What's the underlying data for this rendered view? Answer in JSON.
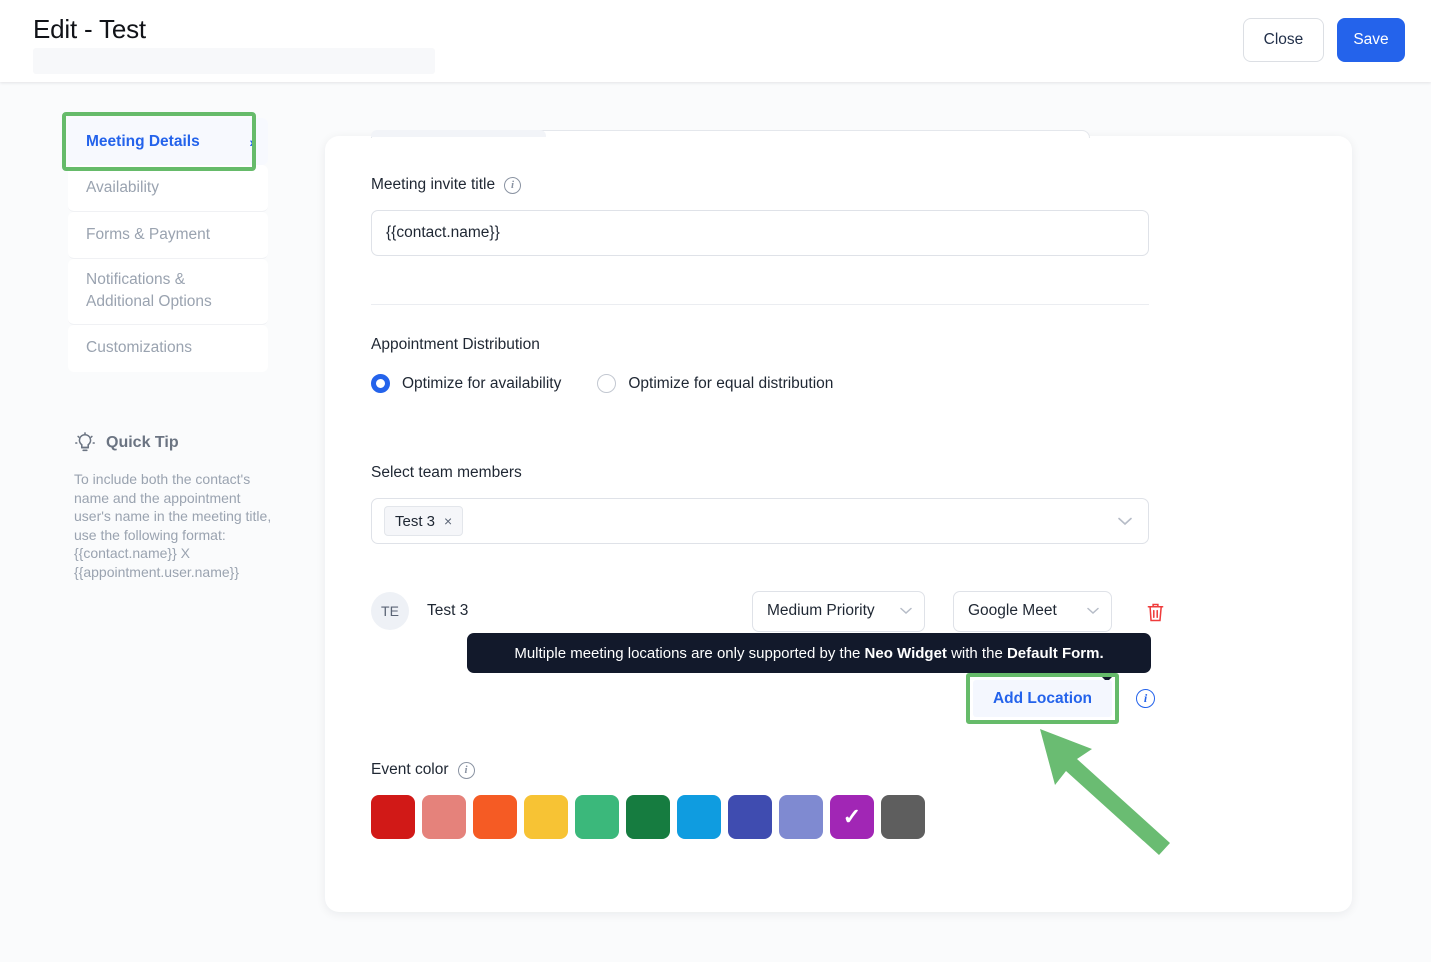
{
  "header": {
    "title": "Edit - Test",
    "close_label": "Close",
    "save_label": "Save",
    "save_color": "#2463eb"
  },
  "sidebar": {
    "items": [
      {
        "label": "Meeting Details",
        "active": true,
        "chevron": "›"
      },
      {
        "label": "Availability",
        "active": false
      },
      {
        "label": "Forms & Payment",
        "active": false
      },
      {
        "label": "Notifications & Additional Options",
        "active": false
      },
      {
        "label": "Customizations",
        "active": false
      }
    ],
    "highlight_color": "#66bb6a"
  },
  "quick_tip": {
    "icon": "lightbulb-icon",
    "title": "Quick Tip",
    "body": "To include both the contact's name and the appointment user's name in the meeting title, use the following format: {{contact.name}} X {{appointment.user.name}}"
  },
  "main": {
    "meeting_invite": {
      "label": "Meeting invite title",
      "info_icon": "info-icon",
      "value": "{{contact.name}}",
      "placeholder": "Meeting invite title"
    },
    "appointment_distribution": {
      "label": "Appointment Distribution",
      "options": [
        {
          "label": "Optimize for availability",
          "selected": true
        },
        {
          "label": "Optimize for equal distribution",
          "selected": false
        }
      ]
    },
    "team_members": {
      "label": "Select team members",
      "chips": [
        {
          "label": "Test 3",
          "remove_icon": "×"
        }
      ],
      "chevron": "⌄"
    },
    "member_rows": [
      {
        "avatar_initials": "TE",
        "name": "Test 3",
        "priority": "Medium Priority",
        "location": "Google Meet",
        "delete_icon": "trash-icon"
      }
    ],
    "tooltip": {
      "text_before": "Multiple meeting locations are only supported by the ",
      "bold_1": "Neo Widget",
      "text_middle": " with the ",
      "bold_2": "Default Form.",
      "background": "#12192b"
    },
    "add_location": {
      "label": "Add Location",
      "info_icon": "info-icon",
      "highlight_color": "#66bb6a"
    },
    "event_color": {
      "label": "Event color",
      "info_icon": "info-icon",
      "selected_index": 9,
      "check_glyph": "✓",
      "swatches": [
        {
          "name": "crimson",
          "hex": "#d11917"
        },
        {
          "name": "salmon",
          "hex": "#e5827b"
        },
        {
          "name": "orange",
          "hex": "#f55b24"
        },
        {
          "name": "yellow",
          "hex": "#f7c334"
        },
        {
          "name": "mint-green",
          "hex": "#3bb87b"
        },
        {
          "name": "forest-green",
          "hex": "#167c40"
        },
        {
          "name": "sky-blue",
          "hex": "#0f9ce0"
        },
        {
          "name": "indigo",
          "hex": "#3f4cb0"
        },
        {
          "name": "periwinkle",
          "hex": "#7f8ad1"
        },
        {
          "name": "purple",
          "hex": "#a126b5"
        },
        {
          "name": "gray",
          "hex": "#5e5e5e"
        }
      ]
    }
  },
  "annotation": {
    "arrow": "green-arrow-pointer",
    "color": "#6abc72"
  }
}
